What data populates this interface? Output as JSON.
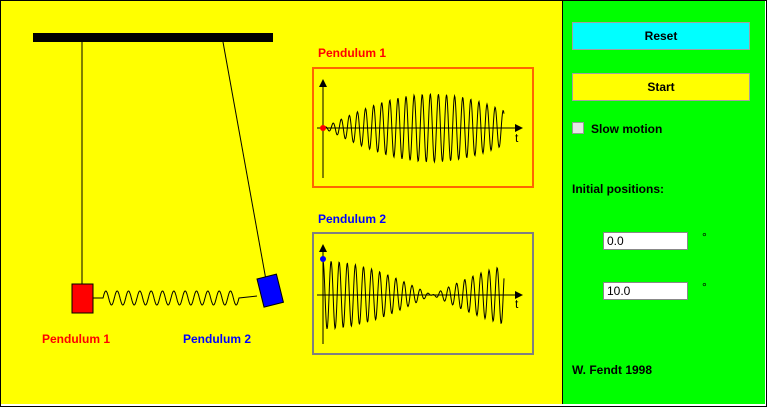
{
  "simulation": {
    "pendulum1_label": "Pendulum 1",
    "pendulum2_label": "Pendulum 2",
    "pendulum1_color": "#ff0000",
    "pendulum2_color": "#0000ff",
    "graph1_title": "Pendulum 1",
    "graph2_title": "Pendulum 2",
    "graph1_border_color": "#ff6600",
    "graph2_border_color": "#808080",
    "time_axis_label": "t"
  },
  "controls": {
    "reset_label": "Reset",
    "start_label": "Start",
    "reset_color": "#00ffff",
    "start_color": "#ffff00",
    "slow_motion_label": "Slow motion",
    "slow_motion_checked": false,
    "initial_positions_label": "Initial positions:",
    "position1_value": "0.0",
    "position2_value": "10.0",
    "degree_unit": "°",
    "credit": "W. Fendt 1998"
  }
}
